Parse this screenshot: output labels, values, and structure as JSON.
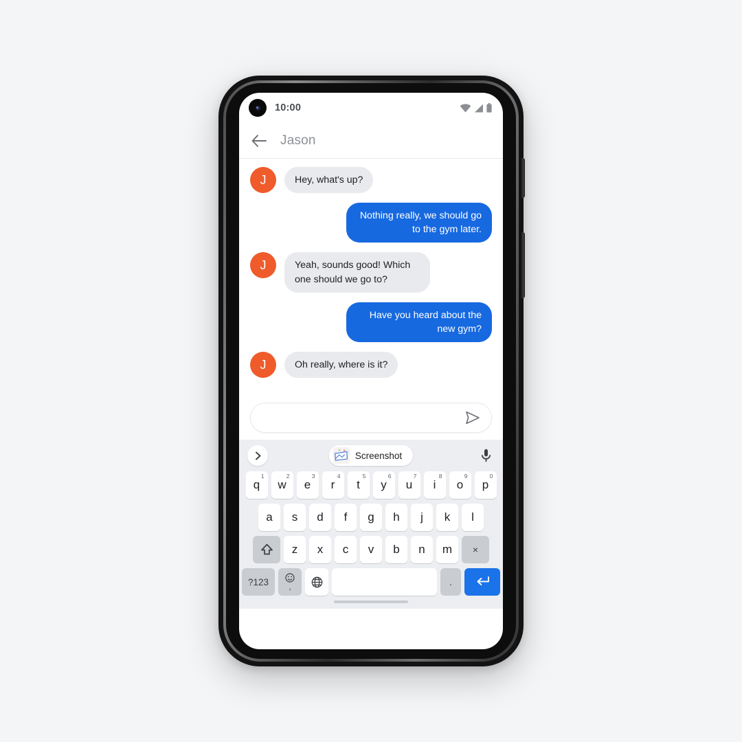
{
  "status_bar": {
    "time": "10:00",
    "icons": [
      "wifi-icon",
      "cellular-signal-icon",
      "battery-icon"
    ]
  },
  "header": {
    "back_icon": "back-arrow-icon",
    "title": "Jason"
  },
  "conversation": {
    "avatar_initial": "J",
    "avatar_color": "#ef5b2b",
    "incoming_bubble_color": "#e9eaed",
    "outgoing_bubble_color": "#1769e0",
    "messages": [
      {
        "side": "in",
        "text": "Hey, what's up?"
      },
      {
        "side": "out",
        "text": "Nothing really, we should go to the gym later."
      },
      {
        "side": "in",
        "text": "Yeah, sounds good! Which one should we go to?"
      },
      {
        "side": "out",
        "text": "Have you heard about the new gym?"
      },
      {
        "side": "in",
        "text": "Oh really, where is it?"
      }
    ]
  },
  "compose": {
    "value": "",
    "placeholder": "",
    "send_icon": "send-icon"
  },
  "keyboard": {
    "suggestion_bar": {
      "expand_icon": "chevron-right-icon",
      "chip_label": "Screenshot",
      "chip_thumbnail": "screenshot-thumbnail",
      "mic_icon": "microphone-icon"
    },
    "row1": [
      {
        "key": "q",
        "num": "1"
      },
      {
        "key": "w",
        "num": "2"
      },
      {
        "key": "e",
        "num": "3"
      },
      {
        "key": "r",
        "num": "4"
      },
      {
        "key": "t",
        "num": "5"
      },
      {
        "key": "y",
        "num": "6"
      },
      {
        "key": "u",
        "num": "7"
      },
      {
        "key": "i",
        "num": "8"
      },
      {
        "key": "o",
        "num": "9"
      },
      {
        "key": "p",
        "num": "0"
      }
    ],
    "row2": [
      "a",
      "s",
      "d",
      "f",
      "g",
      "h",
      "j",
      "k",
      "l"
    ],
    "row3": [
      "z",
      "x",
      "c",
      "v",
      "b",
      "n",
      "m"
    ],
    "shift_icon": "shift-icon",
    "backspace_label": "×",
    "row4": {
      "symbols_label": "?123",
      "emoji_icon": "emoji-icon",
      "comma_label": ",",
      "globe_icon": "globe-icon",
      "space_label": "",
      "period_label": ".",
      "enter_icon": "enter-icon"
    },
    "enter_key_color": "#1a73e8"
  }
}
